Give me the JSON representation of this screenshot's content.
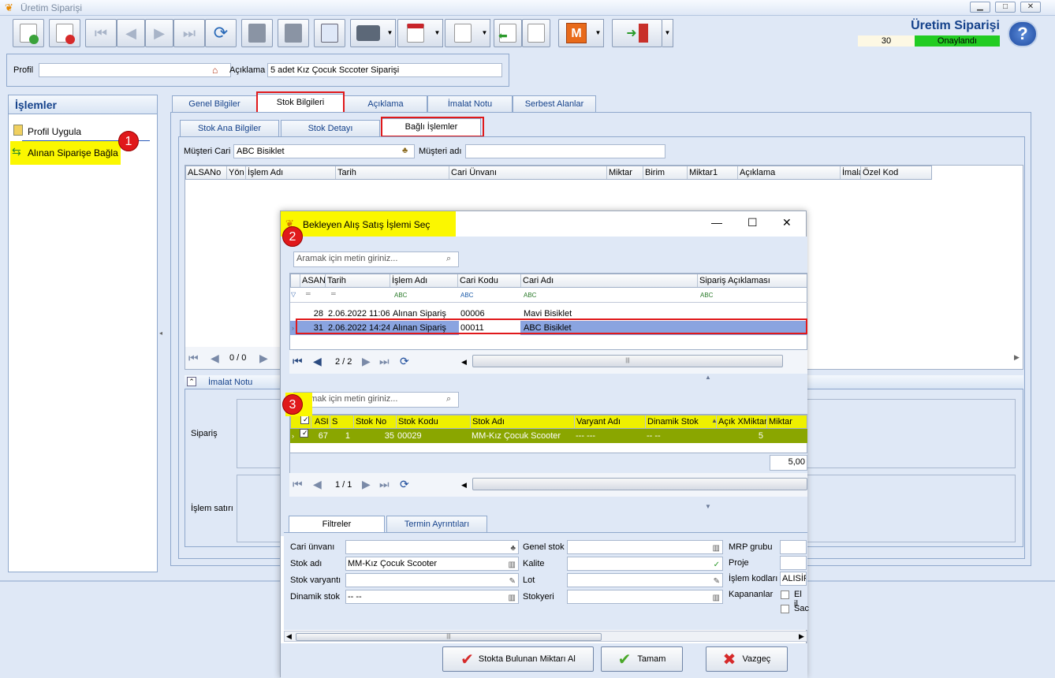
{
  "window": {
    "title": "Üretim Siparişi",
    "minimize": "▁",
    "maximize": "□",
    "close": "✕"
  },
  "header": {
    "title": "Üretim Siparişi",
    "number": "30",
    "status": "Onaylandı",
    "help": "?"
  },
  "profile": {
    "label": "Profil",
    "value": "",
    "desc_label": "Açıklama",
    "desc_value": "5 adet Kız Çocuk Sccoter Siparişi"
  },
  "left": {
    "title": "İşlemler",
    "items": [
      "Profil Uygula",
      "Alınan Siparişe Bağla"
    ]
  },
  "tabs_main": [
    "Genel Bilgiler",
    "Stok Bilgileri",
    "Açıklama",
    "İmalat Notu",
    "Serbest Alanlar"
  ],
  "tabs_sub": [
    "Stok Ana Bilgiler",
    "Stok Detayı",
    "Bağlı İşlemler"
  ],
  "customer": {
    "label": "Müşteri Cari",
    "value": "ABC Bisiklet",
    "name_label": "Müşteri adı",
    "name_value": ""
  },
  "main_grid": {
    "columns": [
      "ALSANo",
      "Yön",
      "İşlem Adı",
      "Tarih",
      "Cari Ünvanı",
      "Miktar",
      "Birim",
      "Miktar1",
      "Açıklama",
      "İmalat",
      "Özel Kod"
    ]
  },
  "main_nav": {
    "count": "0 / 0"
  },
  "imalat": {
    "title": "İmalat Notu",
    "siparis": "Sipariş",
    "islem": "İşlem satırı"
  },
  "markers": [
    "1",
    "2",
    "3"
  ],
  "dialog": {
    "title": "Bekleyen Alış Satış İşlemi Seç",
    "search1_placeholder": "Aramak için metin giriniz...",
    "grid1": {
      "columns": [
        "ASANo",
        "Tarih",
        "İşlem Adı",
        "Cari Kodu",
        "Cari Adı",
        "Sipariş Açıklaması"
      ],
      "rows": [
        {
          "no": "28",
          "date": "2.06.2022 11:06",
          "op": "Alınan Sipariş",
          "code": "00006",
          "name": "Mavi Bisiklet"
        },
        {
          "no": "31",
          "date": "2.06.2022 14:24",
          "op": "Alınan Sipariş",
          "code": "00011",
          "name": "ABC Bisiklet"
        }
      ]
    },
    "nav1": "2 / 2",
    "search2_placeholder": "Aramak için metin giriniz...",
    "grid2": {
      "columns": [
        "ASI",
        "S",
        "Stok No",
        "Stok Kodu",
        "Stok Adı",
        "Varyant Adı",
        "Dinamik Stok",
        "Açık XMiktar",
        "Miktar"
      ],
      "rows": [
        {
          "asi": "67",
          "s": "1",
          "stokno": "35",
          "kodu": "00029",
          "adi": "MM-Kız Çocuk Scooter",
          "varyant": "--- ---",
          "dinamik": "-- --",
          "acik": "5",
          "miktar": ""
        }
      ],
      "total": "5,00"
    },
    "nav2": "1 / 1",
    "filter_tabs": [
      "Filtreler",
      "Termin Ayrıntıları"
    ],
    "filters": {
      "cari_label": "Cari ünvanı",
      "cari": "",
      "stokadi_label": "Stok adı",
      "stokadi": "MM-Kız Çocuk Scooter",
      "varyant_label": "Stok varyantı",
      "varyant": "",
      "dinamik_label": "Dinamik stok",
      "dinamik": "-- --",
      "genel_label": "Genel stok",
      "genel": "",
      "kalite_label": "Kalite",
      "kalite": "",
      "lot_label": "Lot",
      "lot": "",
      "stokyeri_label": "Stokyeri",
      "stokyeri": "",
      "mrp_label": "MRP grubu",
      "mrp": "",
      "proje_label": "Proje",
      "proje": "",
      "islemkod_label": "İşlem kodları",
      "islemkod": "ALISİP",
      "kapanan_label": "Kapananlar",
      "chk1": "El il",
      "chk2": "Sac"
    },
    "buttons": {
      "stok": "Stokta Bulunan Miktarı Al",
      "ok": "Tamam",
      "cancel": "Vazgeç"
    }
  }
}
